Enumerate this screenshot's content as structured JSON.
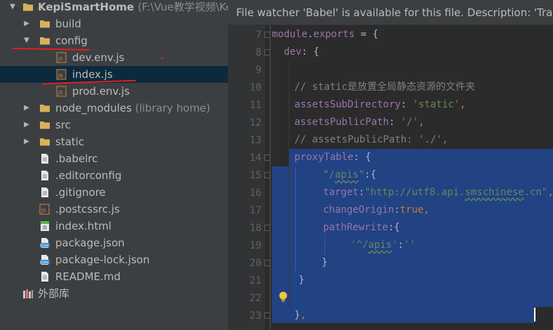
{
  "project_tree": {
    "items": [
      {
        "label": "KepiSmartHome",
        "hint": "(F:\\Vue教学视频\\Kep",
        "type": "folder",
        "level": 0,
        "expanded": true
      },
      {
        "label": "build",
        "type": "folder",
        "level": 1,
        "expanded": false
      },
      {
        "label": "config",
        "type": "folder",
        "level": 1,
        "expanded": true
      },
      {
        "label": "dev.env.js",
        "type": "js",
        "level": 2
      },
      {
        "label": "index.js",
        "type": "js",
        "level": 2,
        "selected": true
      },
      {
        "label": "prod.env.js",
        "type": "js",
        "level": 2
      },
      {
        "label": "node_modules",
        "hint": "(library home)",
        "type": "folder",
        "level": 1,
        "expanded": false
      },
      {
        "label": "src",
        "type": "folder",
        "level": 1,
        "expanded": false
      },
      {
        "label": "static",
        "type": "folder",
        "level": 1,
        "expanded": false
      },
      {
        "label": ".babelrc",
        "type": "file",
        "level": 1
      },
      {
        "label": ".editorconfig",
        "type": "file",
        "level": 1
      },
      {
        "label": ".gitignore",
        "type": "file",
        "level": 1
      },
      {
        "label": ".postcssrc.js",
        "type": "js",
        "level": 1
      },
      {
        "label": "index.html",
        "type": "html",
        "level": 1
      },
      {
        "label": "package.json",
        "type": "json",
        "level": 1
      },
      {
        "label": "package-lock.json",
        "type": "json",
        "level": 1
      },
      {
        "label": "README.md",
        "type": "file",
        "level": 1
      },
      {
        "label": "外部库",
        "type": "library",
        "level": 0
      }
    ]
  },
  "editor": {
    "banner": "File watcher 'Babel' is available for this file. Description: 'Transp",
    "line_numbers": [
      "7",
      "8",
      "9",
      "10",
      "11",
      "12",
      "13",
      "14",
      "15",
      "16",
      "17",
      "18",
      "19",
      "20",
      "21",
      "22",
      "23"
    ],
    "code": {
      "l7a": "module",
      "l7b": ".",
      "l7c": "exports",
      "l7d": " = {",
      "l8a": "dev",
      "l8b": ": {",
      "l10": "// static是放置全局静态资源的文件夹",
      "l11a": "assetsSubDirectory",
      "l11b": ": ",
      "l11c": "'static'",
      "l11d": ",",
      "l12a": "assetsPublicPath",
      "l12b": ": ",
      "l12c": "'/'",
      "l12d": ",",
      "l13": "// assetsPublicPath: './',",
      "l14a": "proxyTable",
      "l14b": ": {",
      "l15a": "\"/",
      "l15b": "apis",
      "l15c": "\"",
      "l15d": ":{",
      "l16a": "target",
      "l16b": ":",
      "l16c": "\"http://utf8.api.",
      "l16d": "smschinese",
      "l16e": ".cn\"",
      "l16f": ",",
      "l17a": "changeOrigin",
      "l17b": ":",
      "l17c": "true",
      "l17d": ",",
      "l18a": "pathRewrite",
      "l18b": ":{",
      "l19a": "'^/",
      "l19b": "apis",
      "l19c": "'",
      "l19d": ":",
      "l19e": "''",
      "l20": "}",
      "l21": "}",
      "l23a": "}",
      "l23b": ","
    }
  },
  "colors": {
    "tree_bg": "#3c3f41",
    "editor_bg": "#2b2b2b",
    "selection": "#214283",
    "keyword": "#cc7832",
    "property": "#9876aa",
    "string": "#6a8759",
    "comment": "#808080",
    "annotation": "#e02020"
  }
}
